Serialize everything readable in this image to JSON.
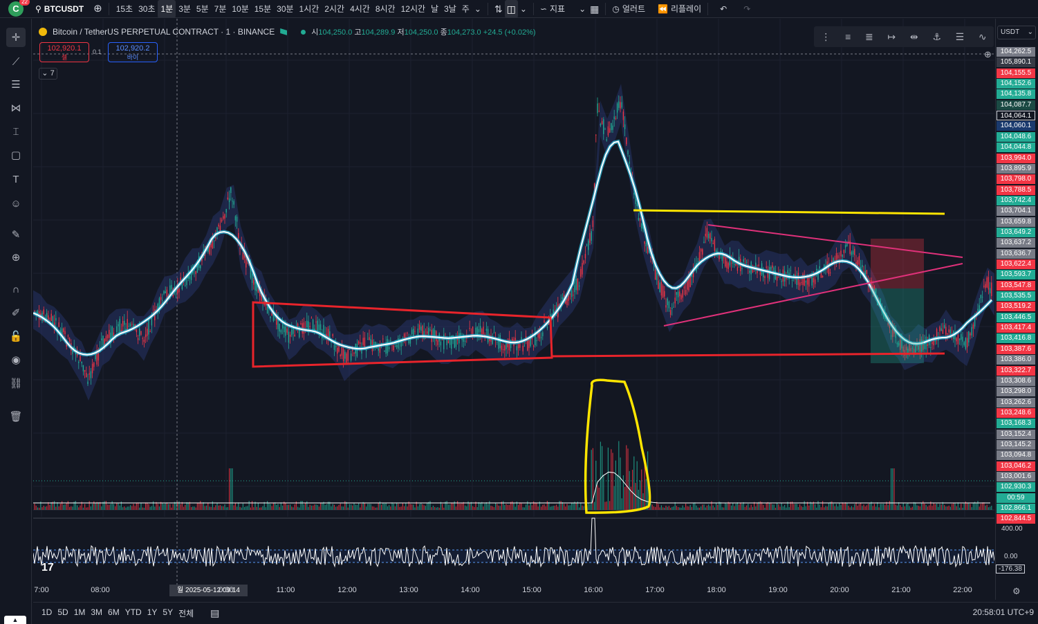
{
  "topbar": {
    "logo_letter": "C",
    "badge": "22",
    "symbol": "BTCUSDT",
    "intervals": [
      "15초",
      "30초",
      "1분",
      "3분",
      "5분",
      "7분",
      "10분",
      "15분",
      "30분",
      "1시간",
      "2시간",
      "4시간",
      "8시간",
      "12시간",
      "날",
      "3날",
      "주"
    ],
    "active_interval": "1분",
    "indicators_label": "지표",
    "alert_label": "얼러트",
    "replay_label": "리플레이"
  },
  "legend": {
    "title": "Bitcoin / TetherUS PERPETUAL CONTRACT · 1 · BINANCE",
    "o_label": "시",
    "o": "104,250.0",
    "h_label": "고",
    "h": "104,289.9",
    "l_label": "저",
    "l": "104,250.0",
    "c_label": "종",
    "c": "104,273.0",
    "change": "+24.5 (+0.02%)"
  },
  "trade": {
    "sell_price": "102,920.1",
    "sell_label": "셀",
    "spread": "0.1",
    "buy_price": "102,920.2",
    "buy_label": "바이"
  },
  "indicator_count": "7",
  "currency": "USDT",
  "price_labels": [
    {
      "v": "104,262.5",
      "c": "#787b86"
    },
    {
      "v": "105,890.1",
      "c": "#363a45"
    },
    {
      "v": "104,155.5",
      "c": "#f23645"
    },
    {
      "v": "104,152.6",
      "c": "#22ab94"
    },
    {
      "v": "104,135.8",
      "c": "#22ab94"
    },
    {
      "v": "104,087.7",
      "c": "#1b4a44"
    },
    {
      "v": "104,064.1",
      "c": "#131722"
    },
    {
      "v": "104,060.1",
      "c": "#1a3a6e"
    },
    {
      "v": "104,048.6",
      "c": "#22ab94"
    },
    {
      "v": "104,044.8",
      "c": "#22ab94"
    },
    {
      "v": "103,994.0",
      "c": "#f23645"
    },
    {
      "v": "103,895.9",
      "c": "#787b86"
    },
    {
      "v": "103,798.0",
      "c": "#f23645"
    },
    {
      "v": "103,788.5",
      "c": "#f23645"
    },
    {
      "v": "103,742.4",
      "c": "#22ab94"
    },
    {
      "v": "103,704.1",
      "c": "#787b86"
    },
    {
      "v": "103,659.8",
      "c": "#787b86"
    },
    {
      "v": "103,649.2",
      "c": "#22ab94"
    },
    {
      "v": "103,637.2",
      "c": "#787b86"
    },
    {
      "v": "103,636.7",
      "c": "#787b86"
    },
    {
      "v": "103,622.4",
      "c": "#f23645"
    },
    {
      "v": "103,593.7",
      "c": "#22ab94"
    },
    {
      "v": "103,547.8",
      "c": "#f23645"
    },
    {
      "v": "103,535.5",
      "c": "#22ab94"
    },
    {
      "v": "103,519.2",
      "c": "#f23645"
    },
    {
      "v": "103,446.5",
      "c": "#22ab94"
    },
    {
      "v": "103,417.4",
      "c": "#f23645"
    },
    {
      "v": "103,416.8",
      "c": "#22ab94"
    },
    {
      "v": "103,387.6",
      "c": "#f23645"
    },
    {
      "v": "103,386.0",
      "c": "#787b86"
    },
    {
      "v": "103,322.7",
      "c": "#f23645"
    },
    {
      "v": "103,308.6",
      "c": "#787b86"
    },
    {
      "v": "103,298.0",
      "c": "#787b86"
    },
    {
      "v": "103,262.6",
      "c": "#787b86"
    },
    {
      "v": "103,248.6",
      "c": "#f23645"
    },
    {
      "v": "103,168.3",
      "c": "#22ab94"
    },
    {
      "v": "103,152.4",
      "c": "#787b86"
    },
    {
      "v": "103,145.2",
      "c": "#787b86"
    },
    {
      "v": "103,094.8",
      "c": "#787b86"
    },
    {
      "v": "103,046.2",
      "c": "#f23645"
    },
    {
      "v": "103,001.6",
      "c": "#787b86"
    },
    {
      "v": "102,930.3",
      "c": "#22ab94"
    },
    {
      "v": "00:59",
      "c": "#22ab94"
    },
    {
      "v": "102,866.1",
      "c": "#22ab94"
    },
    {
      "v": "102,844.5",
      "c": "#f23645"
    }
  ],
  "oscillator": {
    "top": "400.00",
    "zero": "0.00",
    "current": "-176.38"
  },
  "time_labels": [
    "7:00",
    "08:00",
    "0:00",
    "11:00",
    "12:00",
    "13:00",
    "14:00",
    "15:00",
    "16:00",
    "17:00",
    "18:00",
    "19:00",
    "20:00",
    "21:00",
    "22:00"
  ],
  "crosshair_time": "월 2025-05-12   09:14",
  "bottombar": {
    "ranges": [
      "1D",
      "5D",
      "1M",
      "3M",
      "6M",
      "YTD",
      "1Y",
      "5Y",
      "전체"
    ],
    "clock": "20:58:01 UTC+9"
  },
  "colors": {
    "up": "#22ab94",
    "down": "#f23645",
    "ma": "#ffffff",
    "ma_glow": "#2ec4e6",
    "red_box": "#e8242b",
    "yellow": "#ffe500",
    "pink": "#e0317a",
    "cloud": "#2b3a75"
  },
  "icons": [
    "crosshair-icon",
    "trendline-icon",
    "fib-icon",
    "pattern-icon",
    "measure-icon",
    "rectangle-icon",
    "text-icon",
    "emoji-icon",
    "ruler-icon",
    "zoom-icon",
    "magnet-icon",
    "pencil-lock-icon",
    "lock-icon",
    "eye-icon",
    "link-icon",
    "trash-icon"
  ]
}
